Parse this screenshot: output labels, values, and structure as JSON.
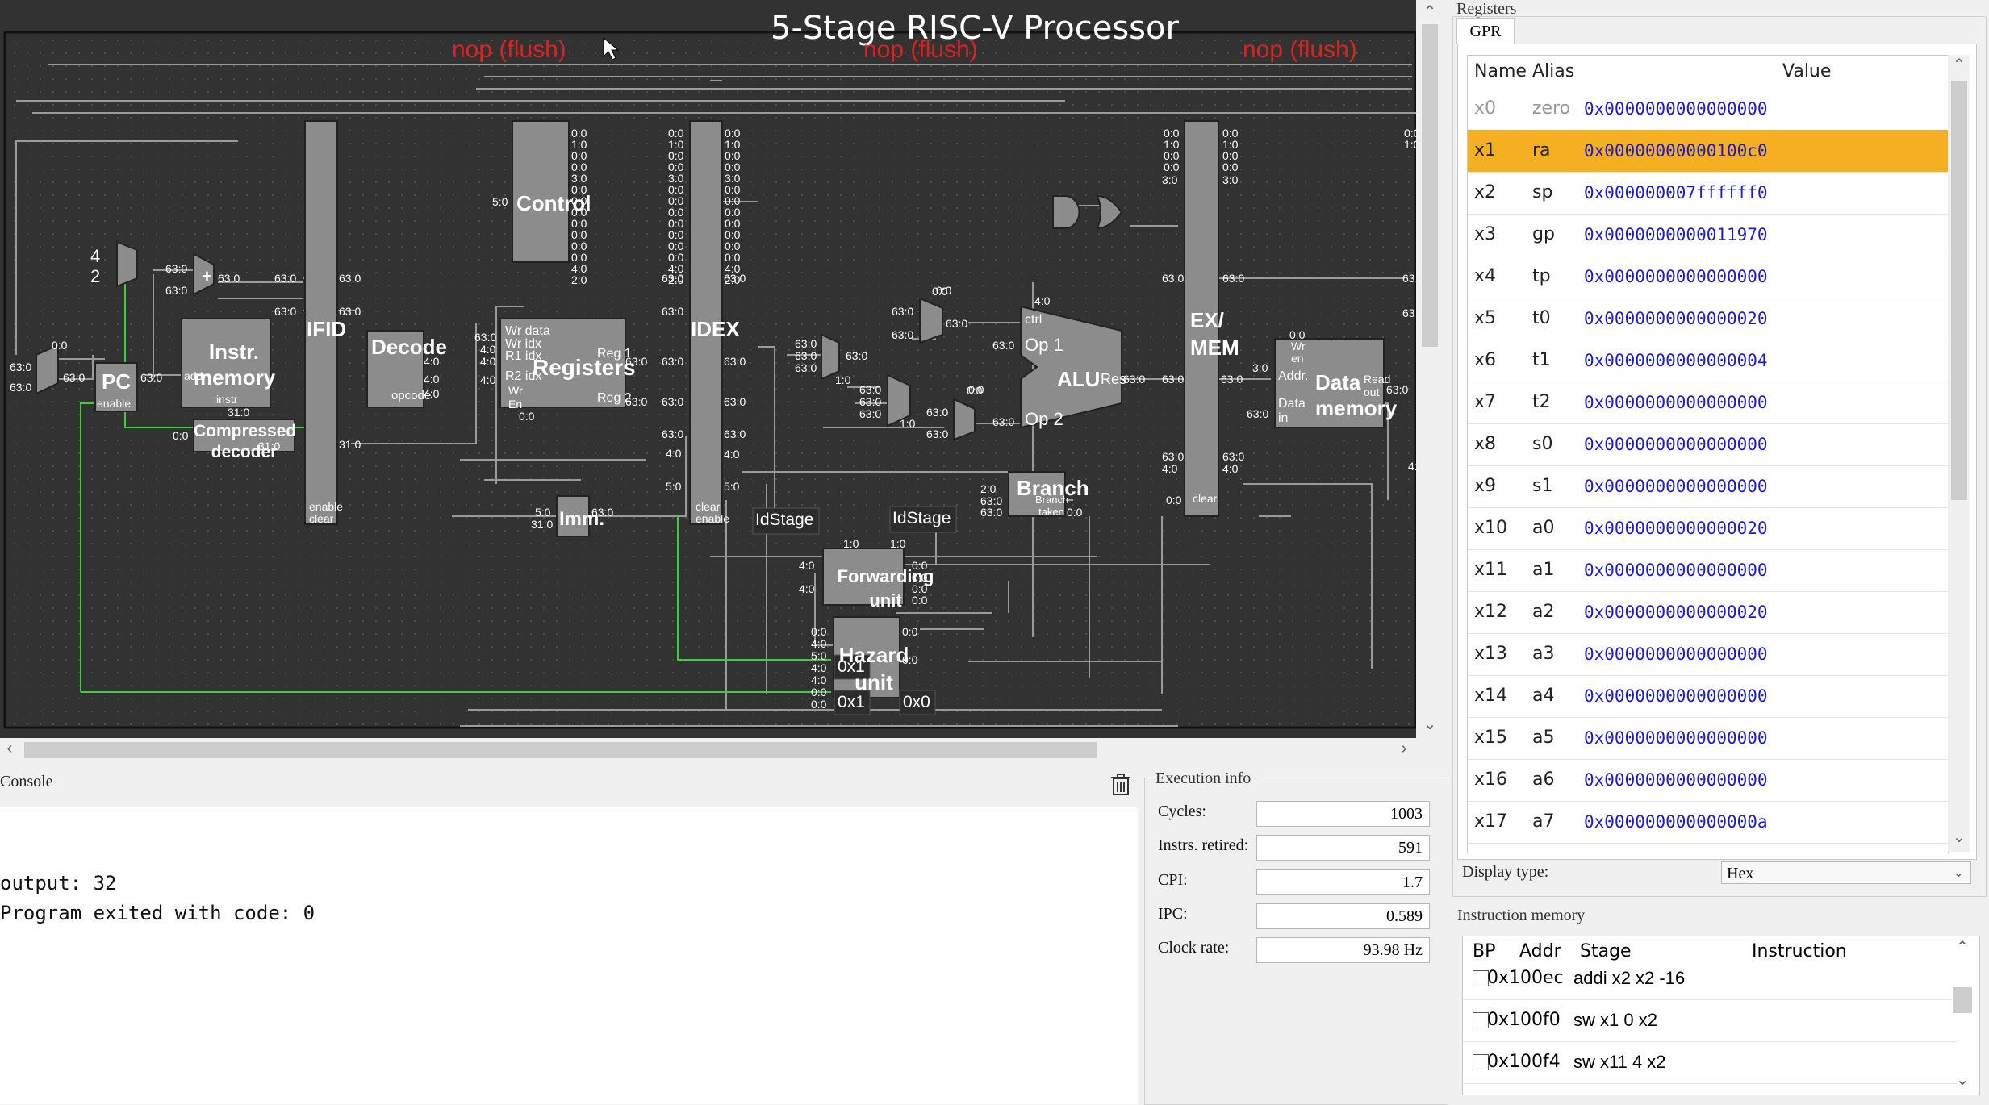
{
  "processor": {
    "title": "5-Stage RISC-V Processor",
    "flush_labels": [
      "nop (flush)",
      "nop (flush)",
      "nop (flush)"
    ],
    "blocks": {
      "pc": "PC",
      "instr_memory": "Instr. memory",
      "compressed_decoder": "Compressed decoder",
      "ifid": "IFID",
      "decode": "Decode",
      "control": "Control",
      "registers": "Registers",
      "imm": "Imm.",
      "idex": "IDEX",
      "alu": "ALU",
      "branch": "Branch",
      "forwarding_unit": "Forwarding unit",
      "hazard_unit": "Hazard unit",
      "exmem": "EX/ MEM",
      "data_memory": "Data memory"
    },
    "ports": {
      "pc_enable": "enable",
      "instr_addr": "addr",
      "instr_out": "instr",
      "ifid_enable": "enable",
      "ifid_clear": "clear",
      "idex_clear": "clear",
      "idex_enable": "enable",
      "decode_opcode": "opcode",
      "reg_wr_data": "Wr data",
      "reg_wr_idx": "Wr idx",
      "reg_r1_idx": "R1 idx",
      "reg_r2_idx": "R2 idx",
      "reg_wr": "Wr",
      "reg_en": "En",
      "reg_1": "Reg 1",
      "reg_2": "Reg 2",
      "alu_ctrl": "ctrl",
      "alu_op1": "Op 1",
      "alu_op2": "Op 2",
      "alu_res": "Res",
      "branch_taken": "Branch taken",
      "dm_wr_en": "Wr en",
      "dm_addr": "Addr.",
      "dm_data_in": "Data in",
      "dm_read_out": "Read out",
      "exmem_clear": "clear"
    },
    "constants": {
      "four": "4",
      "two": "2",
      "hex1a": "0x1",
      "hex1b": "0x1",
      "hex0": "0x0"
    },
    "idstage_a": "IdStage",
    "idstage_b": "IdStage",
    "widths": [
      "63:0",
      "0:0",
      "63:0",
      "4:0",
      "31:0",
      "2:0",
      "1:0",
      "3:0",
      "5:0"
    ]
  },
  "registers": {
    "panel_title": "Registers",
    "tab": "GPR",
    "columns": [
      "Name",
      "Alias",
      "Value"
    ],
    "rows": [
      {
        "name": "x0",
        "alias": "zero",
        "value": "0x0000000000000000"
      },
      {
        "name": "x1",
        "alias": "ra",
        "value": "0x00000000000100c0"
      },
      {
        "name": "x2",
        "alias": "sp",
        "value": "0x000000007ffffff0"
      },
      {
        "name": "x3",
        "alias": "gp",
        "value": "0x0000000000011970"
      },
      {
        "name": "x4",
        "alias": "tp",
        "value": "0x0000000000000000"
      },
      {
        "name": "x5",
        "alias": "t0",
        "value": "0x0000000000000020"
      },
      {
        "name": "x6",
        "alias": "t1",
        "value": "0x0000000000000004"
      },
      {
        "name": "x7",
        "alias": "t2",
        "value": "0x0000000000000000"
      },
      {
        "name": "x8",
        "alias": "s0",
        "value": "0x0000000000000000"
      },
      {
        "name": "x9",
        "alias": "s1",
        "value": "0x0000000000000000"
      },
      {
        "name": "x10",
        "alias": "a0",
        "value": "0x0000000000000020"
      },
      {
        "name": "x11",
        "alias": "a1",
        "value": "0x0000000000000000"
      },
      {
        "name": "x12",
        "alias": "a2",
        "value": "0x0000000000000020"
      },
      {
        "name": "x13",
        "alias": "a3",
        "value": "0x0000000000000000"
      },
      {
        "name": "x14",
        "alias": "a4",
        "value": "0x0000000000000000"
      },
      {
        "name": "x15",
        "alias": "a5",
        "value": "0x0000000000000000"
      },
      {
        "name": "x16",
        "alias": "a6",
        "value": "0x0000000000000000"
      },
      {
        "name": "x17",
        "alias": "a7",
        "value": "0x000000000000000a"
      }
    ],
    "selected_index": 1,
    "display_type_label": "Display type:",
    "display_type_value": "Hex"
  },
  "console": {
    "title": "Console",
    "lines": [
      "output: 32",
      "Program exited with code: 0"
    ]
  },
  "execution_info": {
    "title": "Execution info",
    "cycles_label": "Cycles:",
    "cycles": "1003",
    "retired_label": "Instrs. retired:",
    "retired": "591",
    "cpi_label": "CPI:",
    "cpi": "1.7",
    "ipc_label": "IPC:",
    "ipc": "0.589",
    "clock_label": "Clock rate:",
    "clock": "93.98 Hz"
  },
  "instruction_memory": {
    "title": "Instruction memory",
    "columns": [
      "BP",
      "Addr",
      "Stage",
      "Instruction"
    ],
    "rows": [
      {
        "addr": "0x100ec",
        "stage": "",
        "instr": "addi x2 x2 -16"
      },
      {
        "addr": "0x100f0",
        "stage": "",
        "instr": "sw x1 0 x2"
      },
      {
        "addr": "0x100f4",
        "stage": "",
        "instr": "sw x11 4 x2"
      }
    ]
  },
  "colors": {
    "selected_row": "#f5b021",
    "hex_value": "#1a1ad4",
    "flush_red": "#e02020",
    "wire_green": "#3ad03a",
    "block_gray": "#8c8c8c"
  }
}
